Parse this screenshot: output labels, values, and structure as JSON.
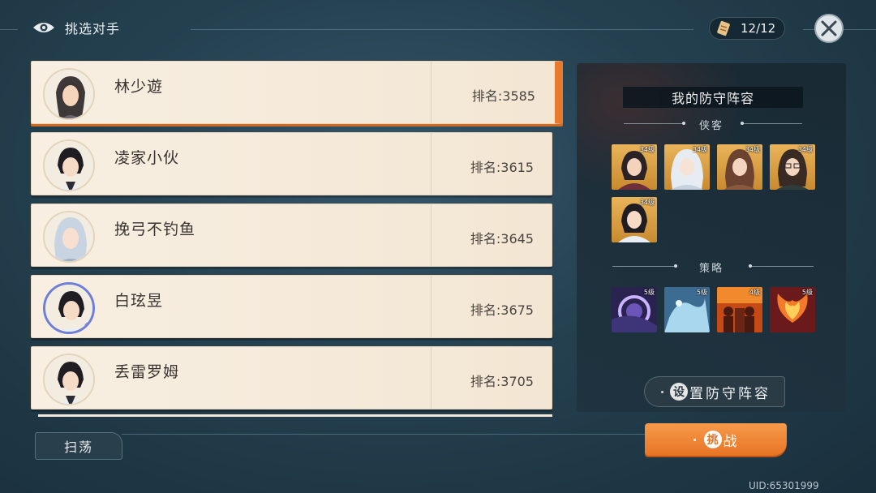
{
  "header": {
    "title": "挑选对手",
    "eye_icon": "eye-icon",
    "tickets": "12/12",
    "ticket_icon": "scroll-ticket-icon",
    "close_icon": "close-swords-icon"
  },
  "opponents": [
    {
      "name": "林少遊",
      "rank": "排名:3585",
      "selected": true
    },
    {
      "name": "凌家小伙",
      "rank": "排名:3615",
      "selected": false
    },
    {
      "name": "挽弓不钓鱼",
      "rank": "排名:3645",
      "selected": false
    },
    {
      "name": "白玹昱",
      "rank": "排名:3675",
      "selected": false
    },
    {
      "name": "丢雷罗姆",
      "rank": "排名:3705",
      "selected": false
    }
  ],
  "sweep_label": "扫荡",
  "defense": {
    "title": "我的防守阵容",
    "heroes_label": "侠客",
    "heroes": [
      {
        "level": "34级"
      },
      {
        "level": "34级"
      },
      {
        "level": "34级"
      },
      {
        "level": "34级"
      },
      {
        "level": "34级"
      }
    ],
    "strategy_label": "策略",
    "strategies": [
      {
        "level": "5级"
      },
      {
        "level": "5级"
      },
      {
        "level": "4级"
      },
      {
        "level": "5级"
      }
    ]
  },
  "set_defense": {
    "circle": "设",
    "rest": "置防守阵容"
  },
  "challenge": {
    "circle": "挑",
    "rest": "战"
  },
  "uid": "UID:65301999",
  "colors": {
    "accent": "#e97a2d",
    "row_bg": "#f6ecdd",
    "panel_bg": "#1e3240"
  }
}
